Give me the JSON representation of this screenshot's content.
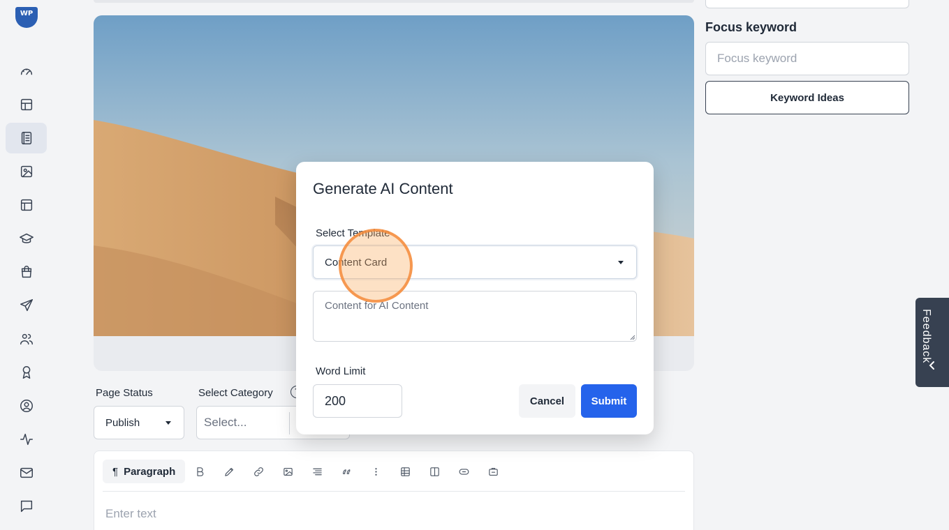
{
  "sidebar": {
    "logo_text": "WP",
    "items": [
      {
        "icon": "dashboard-gauge-icon"
      },
      {
        "icon": "layout-icon"
      },
      {
        "icon": "pages-icon",
        "active": true
      },
      {
        "icon": "image-icon"
      },
      {
        "icon": "template-icon"
      },
      {
        "icon": "graduation-cap-icon"
      },
      {
        "icon": "shopping-bag-icon"
      },
      {
        "icon": "send-icon"
      },
      {
        "icon": "users-icon"
      },
      {
        "icon": "award-icon"
      },
      {
        "icon": "user-circle-icon"
      },
      {
        "icon": "activity-icon"
      },
      {
        "icon": "mail-icon"
      },
      {
        "icon": "message-icon"
      }
    ]
  },
  "page": {
    "status_label": "Page Status",
    "status_value": "Publish",
    "category_label": "Select Category",
    "category_placeholder": "Select...",
    "help_glyph": "?"
  },
  "editor": {
    "paragraph_label": "Paragraph",
    "placeholder": "Enter text"
  },
  "seo": {
    "focus_title": "Focus keyword",
    "focus_placeholder": "Focus keyword",
    "keyword_button": "Keyword Ideas"
  },
  "feedback": {
    "label": "Feedback"
  },
  "modal": {
    "title": "Generate AI Content",
    "template_label": "Select Template",
    "template_value": "Content Card",
    "content_placeholder": "Content for AI Content",
    "word_limit_label": "Word Limit",
    "word_limit_value": "200",
    "cancel_label": "Cancel",
    "submit_label": "Submit"
  },
  "colors": {
    "accent": "#2563eb",
    "sidebar_active": "#e2e6ee",
    "feedback_bg": "#374151",
    "click_ring": "#f58c3c"
  }
}
